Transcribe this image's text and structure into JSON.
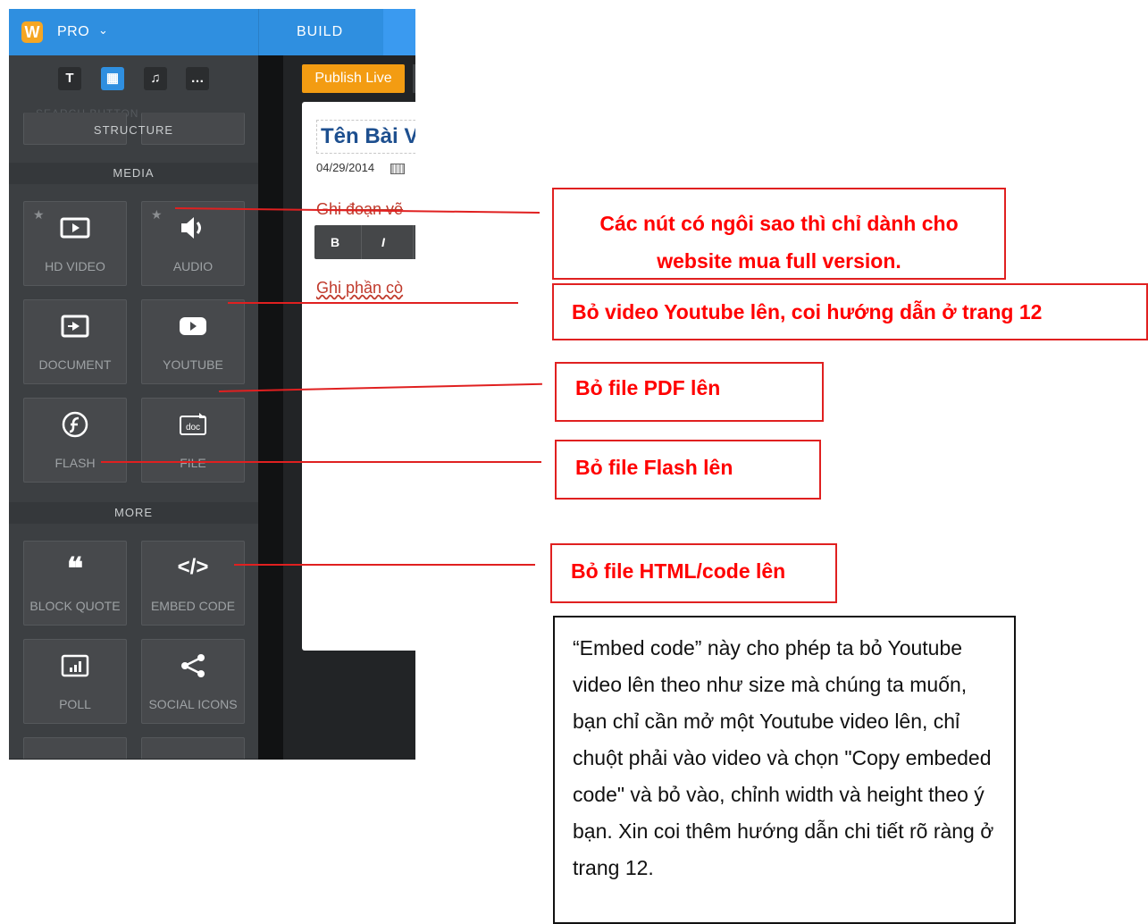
{
  "app": {
    "logo_letter": "W",
    "plan_label": "PRO",
    "plan_chevron": "⌄",
    "build_tab": "BUILD"
  },
  "sidebar": {
    "icon_tabs": [
      "T",
      "▦",
      "♫",
      "…"
    ],
    "ghost_text": "SEARCH     BUTTON",
    "structure_header": "STRUCTURE",
    "media_header": "MEDIA",
    "more_header": "MORE",
    "media_tiles": [
      {
        "label": "HD VIDEO",
        "icon": "video-icon",
        "starred": true
      },
      {
        "label": "AUDIO",
        "icon": "speaker-icon",
        "starred": true
      },
      {
        "label": "DOCUMENT",
        "icon": "document-icon",
        "starred": false
      },
      {
        "label": "YOUTUBE",
        "icon": "youtube-icon",
        "starred": false
      },
      {
        "label": "FLASH",
        "icon": "flash-icon",
        "starred": false
      },
      {
        "label": "FILE",
        "icon": "file-doc-icon",
        "starred": false
      }
    ],
    "more_tiles": [
      {
        "label": "BLOCK QUOTE",
        "icon": "quote-icon"
      },
      {
        "label": "EMBED CODE",
        "icon": "code-icon"
      },
      {
        "label": "POLL",
        "icon": "poll-icon"
      },
      {
        "label": "SOCIAL ICONS",
        "icon": "share-icon"
      }
    ],
    "star_glyph": "★"
  },
  "editor": {
    "publish_button": "Publish Live",
    "post_title": "Tên Bài V",
    "post_date": "04/29/2014",
    "intro_text": "Ghi đoạn vẽ",
    "toolbar_bold": "B",
    "toolbar_italic": "I",
    "body_text": "Ghi phần cò"
  },
  "annotations": {
    "starred_note_line1": "Các nút có ngôi sao thì chỉ dành cho",
    "starred_note_line2": "website mua full version.",
    "youtube_note": "Bỏ video Youtube lên, coi hướng dẫn ở trang 12",
    "pdf_note": "Bỏ file PDF lên",
    "flash_note": "Bỏ file Flash lên",
    "html_note": "Bỏ file HTML/code lên",
    "embed_explanation": "“Embed code” này cho phép ta bỏ Youtube video lên theo như size mà chúng ta muốn, bạn chỉ cần mở một Youtube video lên, chỉ chuột phải vào video và chọn \"Copy embeded code\" và bỏ vào, chỉnh width và height theo ý bạn. Xin coi thêm hướng dẫn chi tiết rõ ràng ở trang 12."
  },
  "colors": {
    "brand_blue": "#2f8fe0",
    "publish_orange": "#f39c12",
    "annotation_red": "#e02020",
    "sidebar_bg": "#3c3f42"
  }
}
